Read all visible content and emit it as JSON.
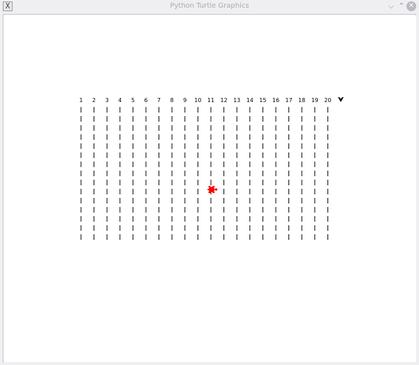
{
  "window": {
    "title": "Python Turtle Graphics",
    "app_icon_glyph": "X",
    "minimize_glyph": "⌵",
    "maximize_glyph": "⌃",
    "close_glyph": "✕"
  },
  "canvas": {
    "background": "#ffffff",
    "line_color": "#000000",
    "columns": [
      "1",
      "2",
      "3",
      "4",
      "5",
      "6",
      "7",
      "8",
      "9",
      "10",
      "11",
      "12",
      "13",
      "14",
      "15",
      "16",
      "17",
      "18",
      "19",
      "20"
    ],
    "dashes_per_column": 15,
    "turtles": [
      {
        "name": "race-turtle-red",
        "shape": "turtle",
        "color": "#ff0000",
        "heading": "east"
      },
      {
        "name": "pen-cursor-black",
        "shape": "classic",
        "color": "#000000",
        "heading": "south"
      }
    ]
  }
}
